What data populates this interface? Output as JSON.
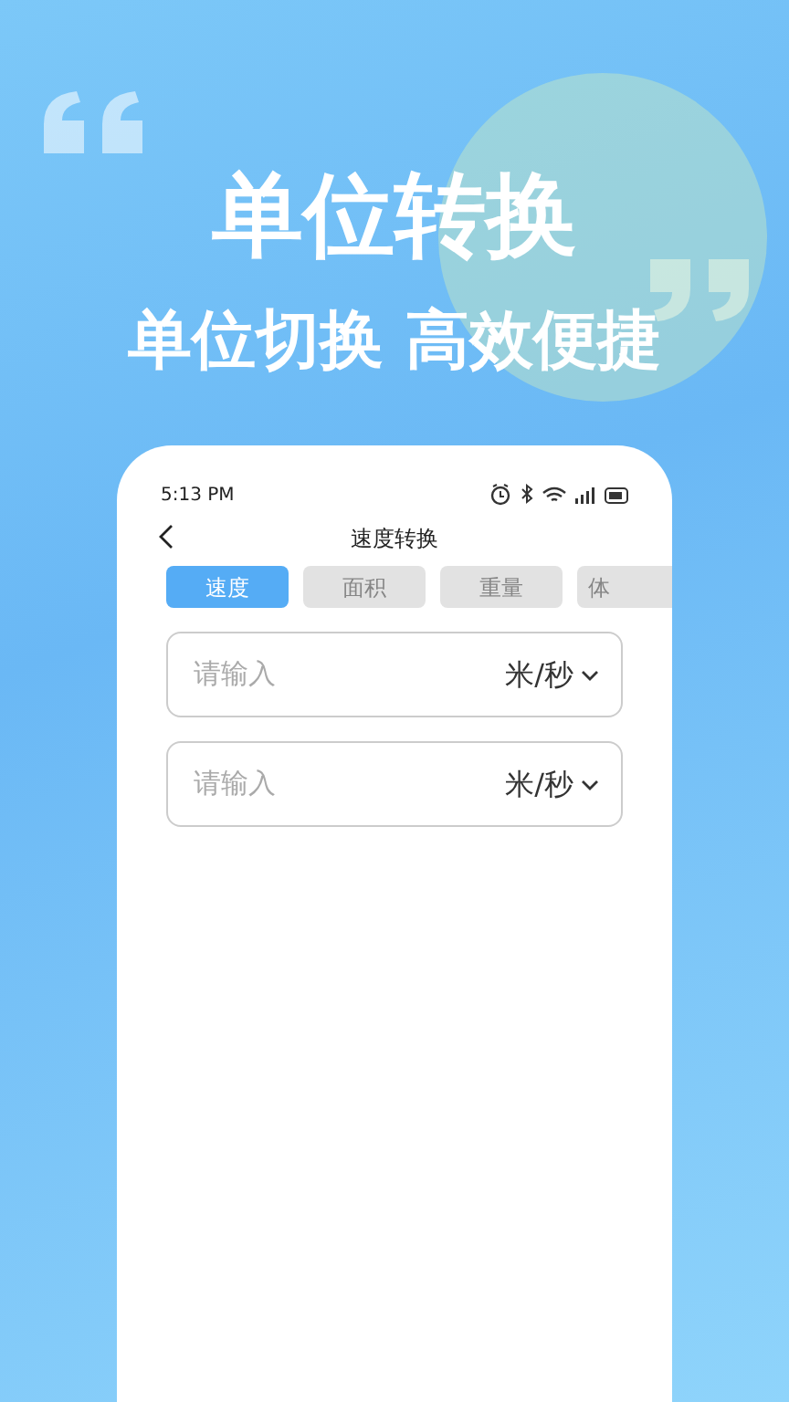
{
  "headline": "单位转换",
  "subtitle": "单位切换 高效便捷",
  "status_bar": {
    "time": "5:13 PM"
  },
  "nav": {
    "title": "速度转换"
  },
  "tabs": [
    {
      "label": "速度",
      "selected": true
    },
    {
      "label": "面积",
      "selected": false
    },
    {
      "label": "重量",
      "selected": false
    },
    {
      "label": "体",
      "selected": false
    }
  ],
  "fields": [
    {
      "placeholder": "请输入",
      "unit": "米/秒"
    },
    {
      "placeholder": "请输入",
      "unit": "米/秒"
    }
  ]
}
